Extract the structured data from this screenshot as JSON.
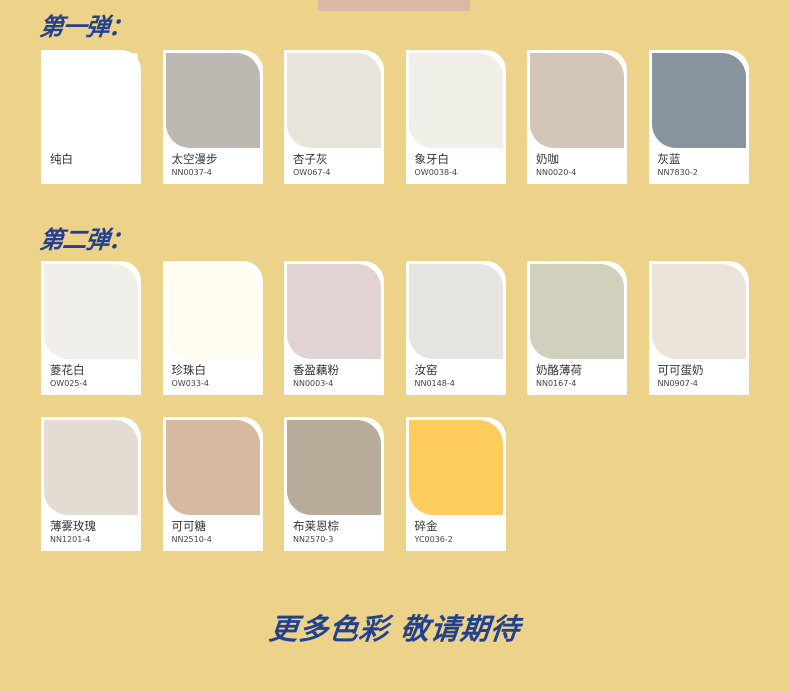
{
  "sections": [
    {
      "title": "第一弹：",
      "colors": [
        {
          "name": "纯白",
          "code": "",
          "hex": "#ffffff"
        },
        {
          "name": "太空漫步",
          "code": "NN0037-4",
          "hex": "#bdb8b1"
        },
        {
          "name": "杏子灰",
          "code": "OW067-4",
          "hex": "#e6e4db"
        },
        {
          "name": "象牙白",
          "code": "OW0038-4",
          "hex": "#f0efe8"
        },
        {
          "name": "奶咖",
          "code": "NN0020-4",
          "hex": "#d3c6b8"
        },
        {
          "name": "灰蓝",
          "code": "NN7830-2",
          "hex": "#87949d"
        }
      ]
    },
    {
      "title": "第二弹：",
      "colors": [
        {
          "name": "菱花白",
          "code": "OW025-4",
          "hex": "#f0efea"
        },
        {
          "name": "珍珠白",
          "code": "OW033-4",
          "hex": "#fffdf0"
        },
        {
          "name": "香盈藕粉",
          "code": "NN0003-4",
          "hex": "#e0d3d1"
        },
        {
          "name": "汝窑",
          "code": "NN0148-4",
          "hex": "#e6e4e0"
        },
        {
          "name": "奶酪薄荷",
          "code": "NN0167-4",
          "hex": "#d0d0bd"
        },
        {
          "name": "可可蛋奶",
          "code": "NN0907-4",
          "hex": "#ebe4da"
        },
        {
          "name": "薄雾玫瑰",
          "code": "NN1201-4",
          "hex": "#e4dbd3"
        },
        {
          "name": "可可糖",
          "code": "NN2510-4",
          "hex": "#d5b9a0"
        },
        {
          "name": "布莱恩棕",
          "code": "NN2570-3",
          "hex": "#b7ab9a"
        },
        {
          "name": "碎金",
          "code": "YC0036-2",
          "hex": "#fecc5c"
        }
      ]
    }
  ],
  "footer": "更多色彩  敬请期待",
  "colors": {
    "background": "#ecd389",
    "heading": "#24418f",
    "ribbon": "#d8b9a6"
  }
}
